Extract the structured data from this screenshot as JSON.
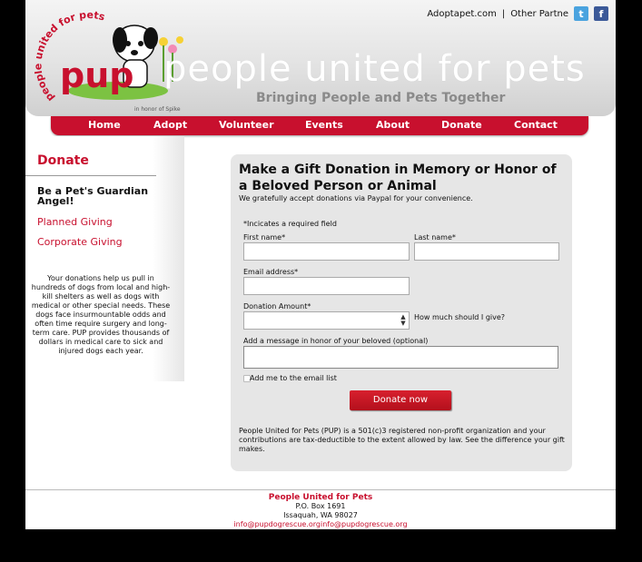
{
  "header": {
    "top_link": "Adoptapet.com",
    "separator": "|",
    "other_partners": "Other Partne",
    "twitter_glyph": "t",
    "facebook_glyph": "f",
    "big_name": "people united for pets",
    "tagline": "Bringing People and Pets Together",
    "logo_text": "pup",
    "logo_arc": "people united for pets",
    "logo_honor": "in honor of Spike"
  },
  "nav": {
    "items": [
      "Home",
      "Adopt",
      "Volunteer",
      "Events",
      "About",
      "Donate",
      "Contact"
    ]
  },
  "sidebar": {
    "title": "Donate",
    "items": [
      "Be a Pet's Guardian Angel!",
      "Planned Giving",
      "Corporate Giving"
    ],
    "blurb": "Your donations help us pull in hundreds of dogs from local and high-kill shelters as well as dogs with medical or other special needs. These dogs face insurmountable odds and often time require surgery and long-term care. PUP provides thousands of dollars in medical care to sick and injured dogs each year."
  },
  "form": {
    "title": "Make a Gift Donation in Memory or Honor of a Beloved Person or Animal",
    "subtitle": "We gratefully accept donations via Paypal for your convenience.",
    "required_note": "*Incicates a required field",
    "first_name_label": "First name*",
    "last_name_label": "Last name*",
    "email_label": "Email address*",
    "amount_label": "Donation Amount*",
    "how_much_label": "How much should I give?",
    "message_label": "Add a message in honor of your beloved (optional)",
    "email_list_label": "Add me to the email list",
    "submit_label": "Donate now",
    "disclaimer": "People United for Pets (PUP) is a 501(c)3 registered non-profit organization and your contributions are tax-deductible to the extent allowed by law. See the difference your gift makes."
  },
  "footer": {
    "org": "People United for Pets",
    "po_box": "P.O. Box 1691",
    "city": "Issaquah, WA 98027",
    "email": "info@pupdogrescue.orginfo@pupdogrescue.org"
  },
  "colors": {
    "brand_red": "#c8102e",
    "panel_gray": "#e6e6e6"
  }
}
